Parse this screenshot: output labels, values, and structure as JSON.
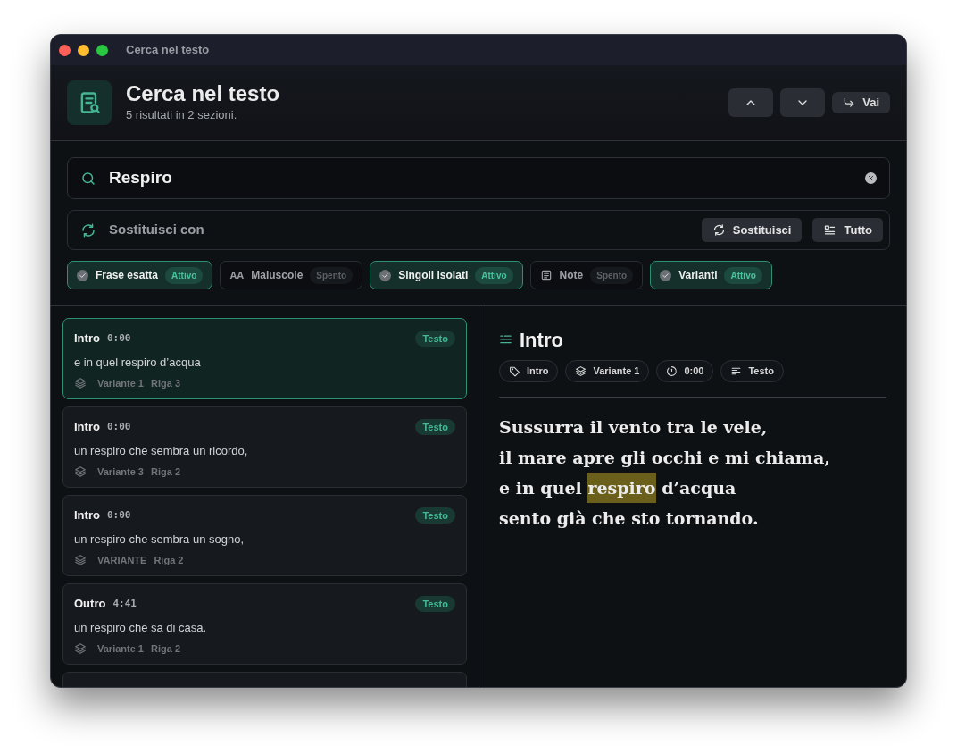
{
  "window": {
    "title": "Cerca nel testo"
  },
  "header": {
    "title": "Cerca nel testo",
    "subtitle": "5 risultati in 2 sezioni."
  },
  "nav_buttons": [
    {
      "kind": "up"
    },
    {
      "kind": "down"
    },
    {
      "kind": "go",
      "label": "Vai"
    }
  ],
  "search": {
    "value": "Respiro"
  },
  "replace": {
    "placeholder": "Sostituisci con",
    "buttons": [
      {
        "kind": "replace",
        "label": "Sostituisci"
      },
      {
        "kind": "all",
        "label": "Tutto"
      }
    ]
  },
  "filters": [
    {
      "kind": "check",
      "label": "Frase esatta",
      "on": true,
      "status": "Attivo"
    },
    {
      "kind": "case",
      "glyph": "AA",
      "label": "Maiuscole",
      "on": false,
      "status": "Spento"
    },
    {
      "kind": "check",
      "label": "Singoli isolati",
      "on": true,
      "status": "Attivo"
    },
    {
      "kind": "note",
      "label": "Note",
      "on": false,
      "status": "Spento"
    },
    {
      "kind": "check",
      "label": "Varianti",
      "on": true,
      "status": "Attivo"
    }
  ],
  "results": [
    {
      "section": "Intro",
      "time": "0:00",
      "tag": "Testo",
      "text": "e in quel respiro d’acqua",
      "variant": "Variante 1",
      "line": "Riga 3",
      "selected": true
    },
    {
      "section": "Intro",
      "time": "0:00",
      "tag": "Testo",
      "text": "un respiro che sembra un ricordo,",
      "variant": "Variante 3",
      "line": "Riga 2",
      "selected": false
    },
    {
      "section": "Intro",
      "time": "0:00",
      "tag": "Testo",
      "text": "un respiro che sembra un sogno,",
      "variant": "VARIANTE",
      "line": "Riga 2",
      "selected": false
    },
    {
      "section": "Outro",
      "time": "4:41",
      "tag": "Testo",
      "text": "un respiro che sa di casa.",
      "variant": "Variante 1",
      "line": "Riga 2",
      "selected": false
    }
  ],
  "detail": {
    "title": "Intro",
    "chips": [
      {
        "kind": "tag",
        "label": "Intro"
      },
      {
        "kind": "layers",
        "label": "Variante 1"
      },
      {
        "kind": "timer",
        "label": "0:00"
      },
      {
        "kind": "lines",
        "label": "Testo"
      }
    ],
    "lines": [
      {
        "text": "Sussurra il vento tra le vele,"
      },
      {
        "text": "il mare apre gli occhi e mi chiama,"
      },
      {
        "text": "e in quel",
        "match": "respiro",
        "after": "d’acqua"
      },
      {
        "text": "sento già che sto tornando."
      }
    ]
  }
}
